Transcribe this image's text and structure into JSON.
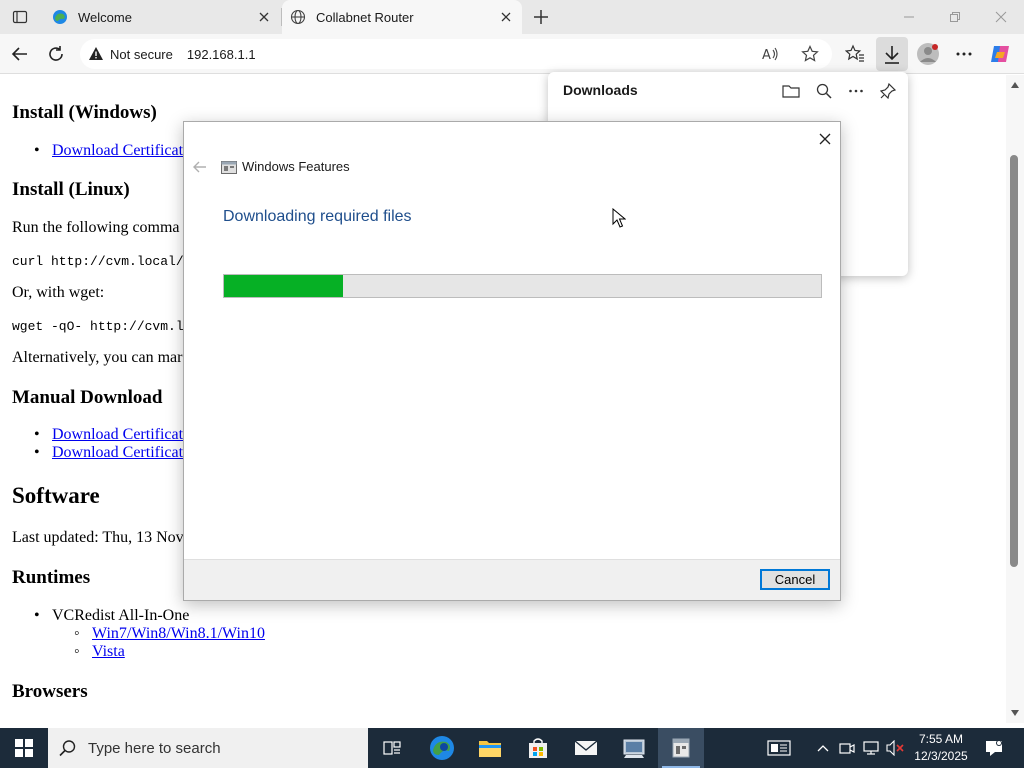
{
  "browser": {
    "tabs": [
      {
        "label": "Welcome",
        "active": false
      },
      {
        "label": "Collabnet Router",
        "active": true
      }
    ],
    "address": {
      "security_label": "Not secure",
      "url": "192.168.1.1"
    }
  },
  "page": {
    "headings": {
      "install_windows": "Install (Windows)",
      "install_linux": "Install (Linux)",
      "manual_download": "Manual Download",
      "software": "Software",
      "runtimes": "Runtimes",
      "browsers": "Browsers"
    },
    "links": {
      "download_cert_1": "Download Certificat",
      "download_cert_2": "Download Certificat",
      "download_cert_3": "Download Certificat",
      "win_versions": "Win7/Win8/Win8.1/Win10",
      "vista": "Vista"
    },
    "text": {
      "run_following": "Run the following comma",
      "curl_cmd": "curl http://cvm.local/l",
      "or_wget": "Or, with wget:",
      "wget_cmd": "wget -qO- http://cvm.loc",
      "alternatively": "Alternatively, you can mar",
      "last_updated": "Last updated: Thu, 13 Nov",
      "vcredist": "VCRedist All-In-One"
    }
  },
  "downloads_panel": {
    "title": "Downloads"
  },
  "dialog": {
    "window_title": "Windows Features",
    "heading": "Downloading required files",
    "progress": 0.2,
    "progress_color": "#06b025",
    "cancel_label": "Cancel"
  },
  "taskbar": {
    "search_placeholder": "Type here to search",
    "time": "7:55 AM",
    "date": "12/3/2025"
  }
}
